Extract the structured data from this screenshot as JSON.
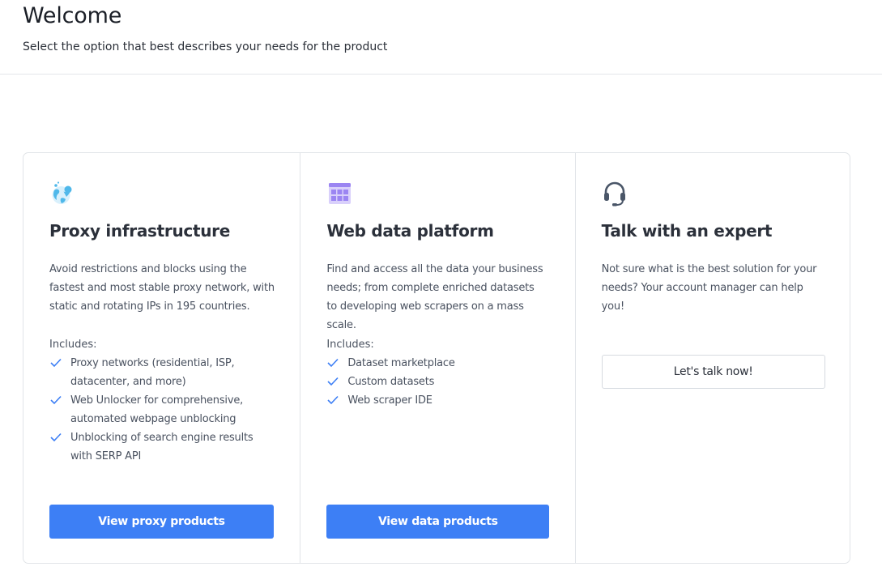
{
  "header": {
    "title": "Welcome",
    "subtitle": "Select the option that best describes your needs for the product"
  },
  "colors": {
    "accent": "#3d7ff5",
    "icon_purple": "#9b85f2",
    "icon_globe": "#4fb8ea",
    "icon_headset": "#4a5668"
  },
  "cards": [
    {
      "icon": "globe-icon",
      "title": "Proxy infrastructure",
      "description": "Avoid restrictions and blocks using the fastest and most stable proxy network, with static and rotating IPs in 195 countries.",
      "includes_label": "Includes:",
      "features": [
        "Proxy networks (residential, ISP, datacenter, and more)",
        "Web Unlocker for comprehensive, automated webpage unblocking",
        "Unblocking of search engine results with SERP API"
      ],
      "button": "View proxy products"
    },
    {
      "icon": "table-grid-icon",
      "title": "Web data platform",
      "description": "Find and access all the data your business needs; from complete enriched datasets to developing web scrapers on a mass scale.",
      "includes_label": "Includes:",
      "features": [
        "Dataset marketplace",
        "Custom datasets",
        "Web scraper IDE"
      ],
      "button": "View data products"
    },
    {
      "icon": "headset-icon",
      "title": "Talk with an expert",
      "description": "Not sure what is the best solution for your needs? Your account manager can help you!",
      "button": "Let's talk now!"
    }
  ]
}
